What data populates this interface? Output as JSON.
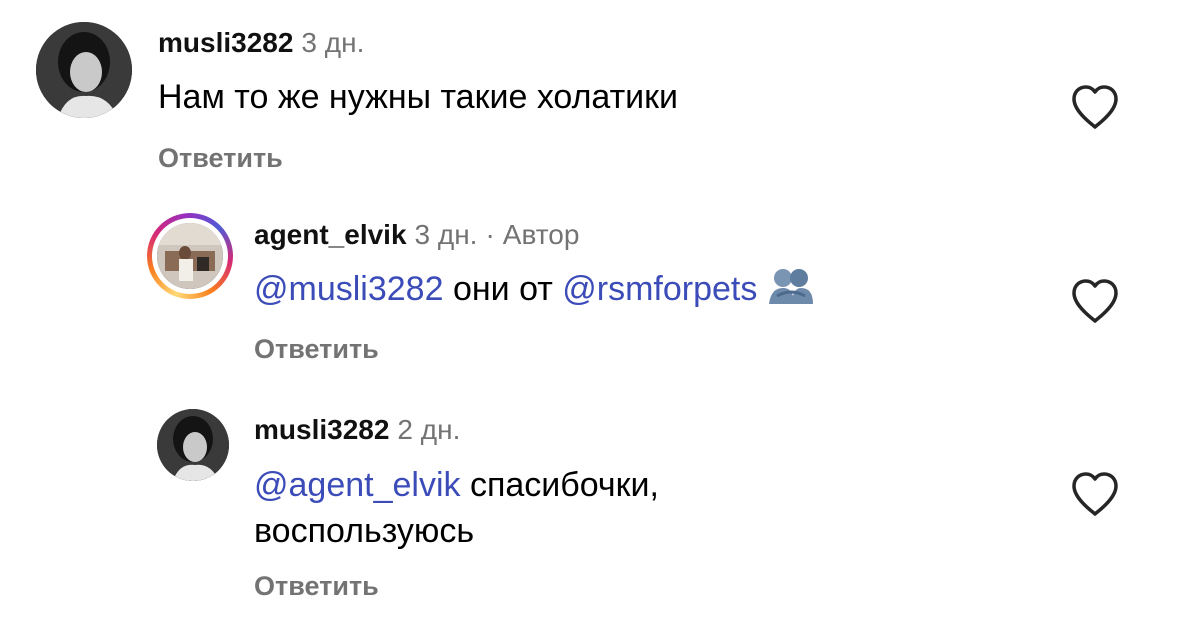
{
  "comments": [
    {
      "username": "musli3282",
      "time": "3 дн.",
      "text": "Нам то же нужны такие холатики",
      "reply_label": "Ответить"
    },
    {
      "username": "agent_elvik",
      "time": "3 дн.",
      "separator": "·",
      "author_badge": "Автор",
      "mention1": "@musli3282",
      "text_middle": " они от ",
      "mention2": "@rsmforpets",
      "emoji_icon": "people-hugging-icon",
      "reply_label": "Ответить"
    },
    {
      "username": "musli3282",
      "time": "2 дн.",
      "mention": "@agent_elvik",
      "text": " спасибочки, воспользуюсь",
      "reply_label": "Ответить"
    }
  ],
  "icons": {
    "like": "heart-outline-icon"
  },
  "colors": {
    "mention": "#3b4cb8",
    "secondary_text": "#737373"
  }
}
